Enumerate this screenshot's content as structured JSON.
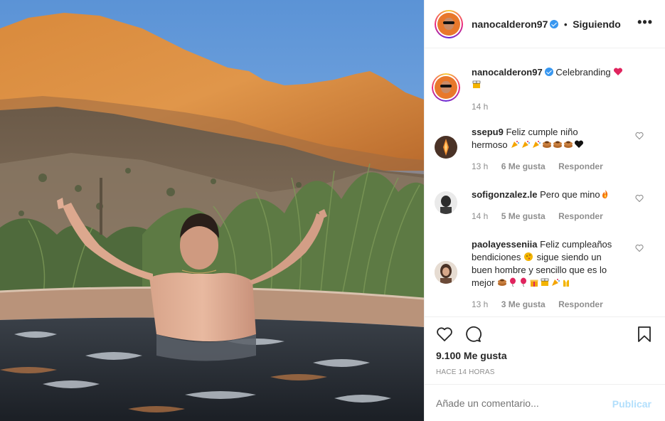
{
  "post": {
    "author": "nanocalderon97",
    "separator": "•",
    "follow_status": "Siguiendo",
    "more_icon": "more-horizontal-icon"
  },
  "caption": {
    "author": "nanocalderon97",
    "text": "Celebranding",
    "emojis": [
      "red-heart-emoji",
      "beer-mugs-emoji"
    ],
    "time": "14 h"
  },
  "comments": [
    {
      "author": "ssepu9",
      "text_line1": "Feliz cumple niño",
      "text_line2": "hermoso",
      "emojis": [
        "party-popper-emoji",
        "party-popper-emoji",
        "party-popper-emoji",
        "pancakes-emoji",
        "pancakes-emoji",
        "pancakes-emoji",
        "black-heart-emoji"
      ],
      "time": "13 h",
      "likes": "6 Me gusta",
      "reply": "Responder"
    },
    {
      "author": "sofigonzalez.le",
      "text_line1": "Pero que mino",
      "emojis": [
        "fire-emoji"
      ],
      "time": "14 h",
      "likes": "5 Me gusta",
      "reply": "Responder"
    },
    {
      "author": "paolayesseniia",
      "text_line1": "Feliz cumpleaños",
      "text_line2": "bendiciones",
      "text_line2b": "sigue siendo un",
      "text_line3": "buen hombre y sencillo que es lo",
      "text_line4": "mejor",
      "emojis": [
        "pancakes-emoji",
        "balloon-emoji",
        "balloon-emoji",
        "gift-emoji",
        "beer-mugs-emoji",
        "party-popper-emoji",
        "praise-hands-emoji"
      ],
      "time": "13 h",
      "likes": "3 Me gusta",
      "reply": "Responder"
    }
  ],
  "actions": {
    "likes": "9.100 Me gusta",
    "ago": "HACE 14 HORAS"
  },
  "composer": {
    "placeholder": "Añade un comentario...",
    "publish": "Publicar"
  },
  "colors": {
    "link_blue": "#3897f0",
    "publish_disabled": "#b2dffc",
    "meta_gray": "#8e8e8e"
  }
}
